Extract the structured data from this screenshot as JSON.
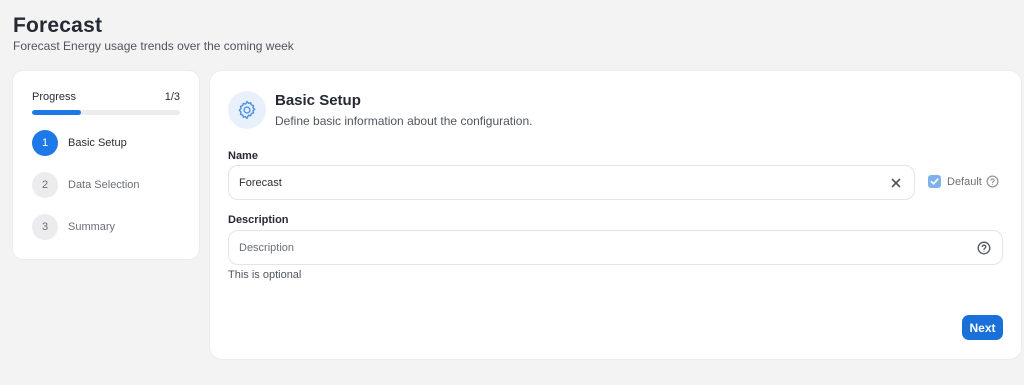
{
  "page": {
    "title": "Forecast",
    "subtitle": "Forecast Energy usage trends over the coming week"
  },
  "progress": {
    "label": "Progress",
    "count": "1/3",
    "fraction": 0.333,
    "steps": [
      {
        "number": "1",
        "label": "Basic Setup",
        "active": true
      },
      {
        "number": "2",
        "label": "Data Selection",
        "active": false
      },
      {
        "number": "3",
        "label": "Summary",
        "active": false
      }
    ]
  },
  "section": {
    "icon": "gear-icon",
    "title": "Basic Setup",
    "description": "Define basic information about the configuration."
  },
  "form": {
    "name_label": "Name",
    "name_value": "Forecast",
    "default_label": "Default",
    "default_checked": true,
    "description_label": "Description",
    "description_placeholder": "Description",
    "description_hint": "This is optional"
  },
  "actions": {
    "next_label": "Next"
  },
  "colors": {
    "accent": "#1f78e8",
    "background": "#f3f3f4"
  }
}
